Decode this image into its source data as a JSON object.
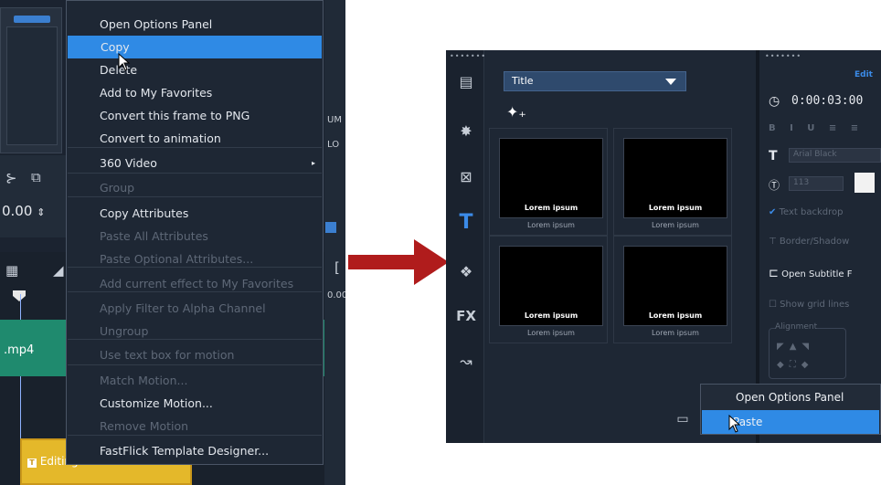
{
  "left_menu": {
    "items": [
      {
        "label": "Open Options Panel",
        "disabled": false
      },
      {
        "label": "Copy",
        "disabled": false,
        "highlighted": true
      },
      {
        "label": "Delete",
        "disabled": false
      },
      {
        "label": "Add to My Favorites",
        "disabled": false
      },
      {
        "label": "Convert this frame to PNG",
        "disabled": false
      },
      {
        "label": "Convert to animation",
        "disabled": false
      },
      {
        "label": "360 Video",
        "disabled": false,
        "submenu": true
      },
      {
        "label": "Group",
        "disabled": true
      },
      {
        "label": "Copy Attributes",
        "disabled": false
      },
      {
        "label": "Paste All Attributes",
        "disabled": true
      },
      {
        "label": "Paste Optional Attributes...",
        "disabled": true
      },
      {
        "label": "Add current effect to My Favorites",
        "disabled": true
      },
      {
        "label": "Apply Filter to Alpha Channel",
        "disabled": true
      },
      {
        "label": "Ungroup",
        "disabled": true
      },
      {
        "label": "Use text box for motion",
        "disabled": true
      },
      {
        "label": "Match Motion...",
        "disabled": true
      },
      {
        "label": "Customize Motion...",
        "disabled": false
      },
      {
        "label": "Remove Motion",
        "disabled": true
      },
      {
        "label": "FastFlick Template Designer...",
        "disabled": false
      }
    ],
    "submenu_arrow": "▸"
  },
  "left_background": {
    "time_value": "0.00",
    "clip_label": ".mp4",
    "yellow_clip_label": "Editing Audio",
    "side_labels": [
      "UM",
      "LO",
      "0.00"
    ]
  },
  "right_panel": {
    "dropdown_value": "Title",
    "add_effect_icon": "✦₊",
    "thumbnails": [
      {
        "title": "Lorem ipsum",
        "subtitle": "Lorem ipsum"
      },
      {
        "title": "Lorem ipsum",
        "subtitle": "Lorem ipsum"
      },
      {
        "title": "Lorem ipsum",
        "subtitle": "Lorem ipsum"
      },
      {
        "title": "Lorem ipsum",
        "subtitle": "Lorem ipsum"
      }
    ],
    "sidebar_icons": [
      "media-icon",
      "instant-project-icon",
      "transition-icon",
      "title-icon",
      "graphics-icon",
      "fx-icon",
      "path-icon"
    ],
    "fx_label": "FX",
    "title_icon_label": "T",
    "options": {
      "tab_label": "Edit",
      "timecode": "0:00:03:00",
      "font_name": "Arial Black",
      "font_size": "113",
      "text_backdrop": "Text backdrop",
      "border_shadow": "Border/Shadow",
      "open_subtitle": "Open Subtitle F",
      "show_grid": "Show grid lines",
      "alignment": "Alignment"
    }
  },
  "right_menu": {
    "items": [
      {
        "label": "Open Options Panel",
        "highlighted": false
      },
      {
        "label": "Paste",
        "highlighted": true
      }
    ]
  },
  "colors": {
    "arrow": "#b01c1c",
    "highlight": "#2f8ae5"
  }
}
